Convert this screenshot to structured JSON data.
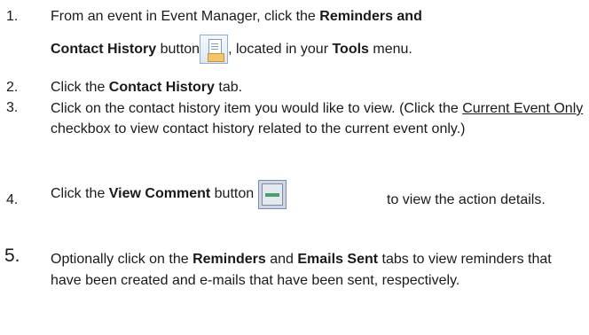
{
  "steps": [
    {
      "number": "1.",
      "line1_text1": "From an event in Event Manager, click the ",
      "line1_bold1": "Reminders and",
      "line2_bold1": "Contact History",
      "line2_text1": " button",
      "line2_text2": ", located in your ",
      "line2_bold2": "Tools",
      "line2_text3": " menu.",
      "icon": "reminders-contact-history-icon"
    },
    {
      "number": "2.",
      "text1": "Click the ",
      "bold1": "Contact History",
      "text2": " tab."
    },
    {
      "number": "3.",
      "text1": "Click on the contact history item you would like to view. (Click the ",
      "underline1": "Current Event Only",
      "text2": " checkbox to view contact history related to the current event only.)"
    },
    {
      "number": "4.",
      "text1": "Click the ",
      "bold1": "View Comment",
      "text2": " button ",
      "text3": " to view the action details.",
      "icon": "view-comment-icon"
    },
    {
      "number": "5.",
      "text1": "Optionally click on the ",
      "bold1": "Reminders",
      "text2": " and ",
      "bold2": "Emails Sent",
      "text3": " tabs to view reminders that have been created and e-mails that have been sent, respectively."
    }
  ]
}
